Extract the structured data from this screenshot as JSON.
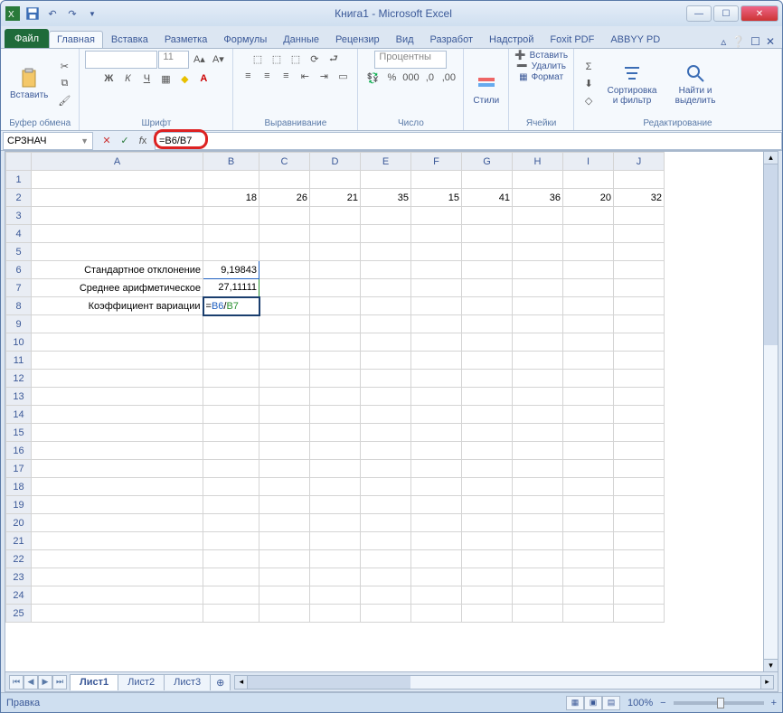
{
  "title": "Книга1 - Microsoft Excel",
  "tabs": {
    "file": "Файл",
    "items": [
      "Главная",
      "Вставка",
      "Разметка",
      "Формулы",
      "Данные",
      "Рецензир",
      "Вид",
      "Разработ",
      "Надстрой",
      "Foxit PDF",
      "ABBYY PD"
    ],
    "active_index": 0
  },
  "ribbon": {
    "clipboard": {
      "paste": "Вставить",
      "label": "Буфер обмена"
    },
    "font": {
      "name": "",
      "size": "11",
      "label": "Шрифт"
    },
    "alignment": {
      "label": "Выравнивание"
    },
    "number": {
      "format": "Процентны",
      "label": "Число"
    },
    "styles": {
      "btn": "Стили",
      "label": ""
    },
    "cells": {
      "insert": "Вставить",
      "delete": "Удалить",
      "format": "Формат",
      "label": "Ячейки"
    },
    "editing": {
      "sort": "Сортировка и фильтр",
      "find": "Найти и выделить",
      "label": "Редактирование"
    }
  },
  "name_box": "СРЗНАЧ",
  "formula": "=B6/B7",
  "columns": [
    "A",
    "B",
    "C",
    "D",
    "E",
    "F",
    "G",
    "H",
    "I",
    "J"
  ],
  "row_count": 25,
  "data_row2": [
    "",
    "18",
    "26",
    "21",
    "35",
    "15",
    "41",
    "36",
    "20",
    "32"
  ],
  "row6": {
    "A": "Стандартное отклонение",
    "B": "9,19843"
  },
  "row7": {
    "A": "Среднее арифметическое",
    "B": "27,11111"
  },
  "row8": {
    "A": "Коэффициент вариации",
    "B": "=B6/B7"
  },
  "sheet_tabs": [
    "Лист1",
    "Лист2",
    "Лист3"
  ],
  "active_sheet": 0,
  "status": "Правка",
  "zoom": "100%"
}
